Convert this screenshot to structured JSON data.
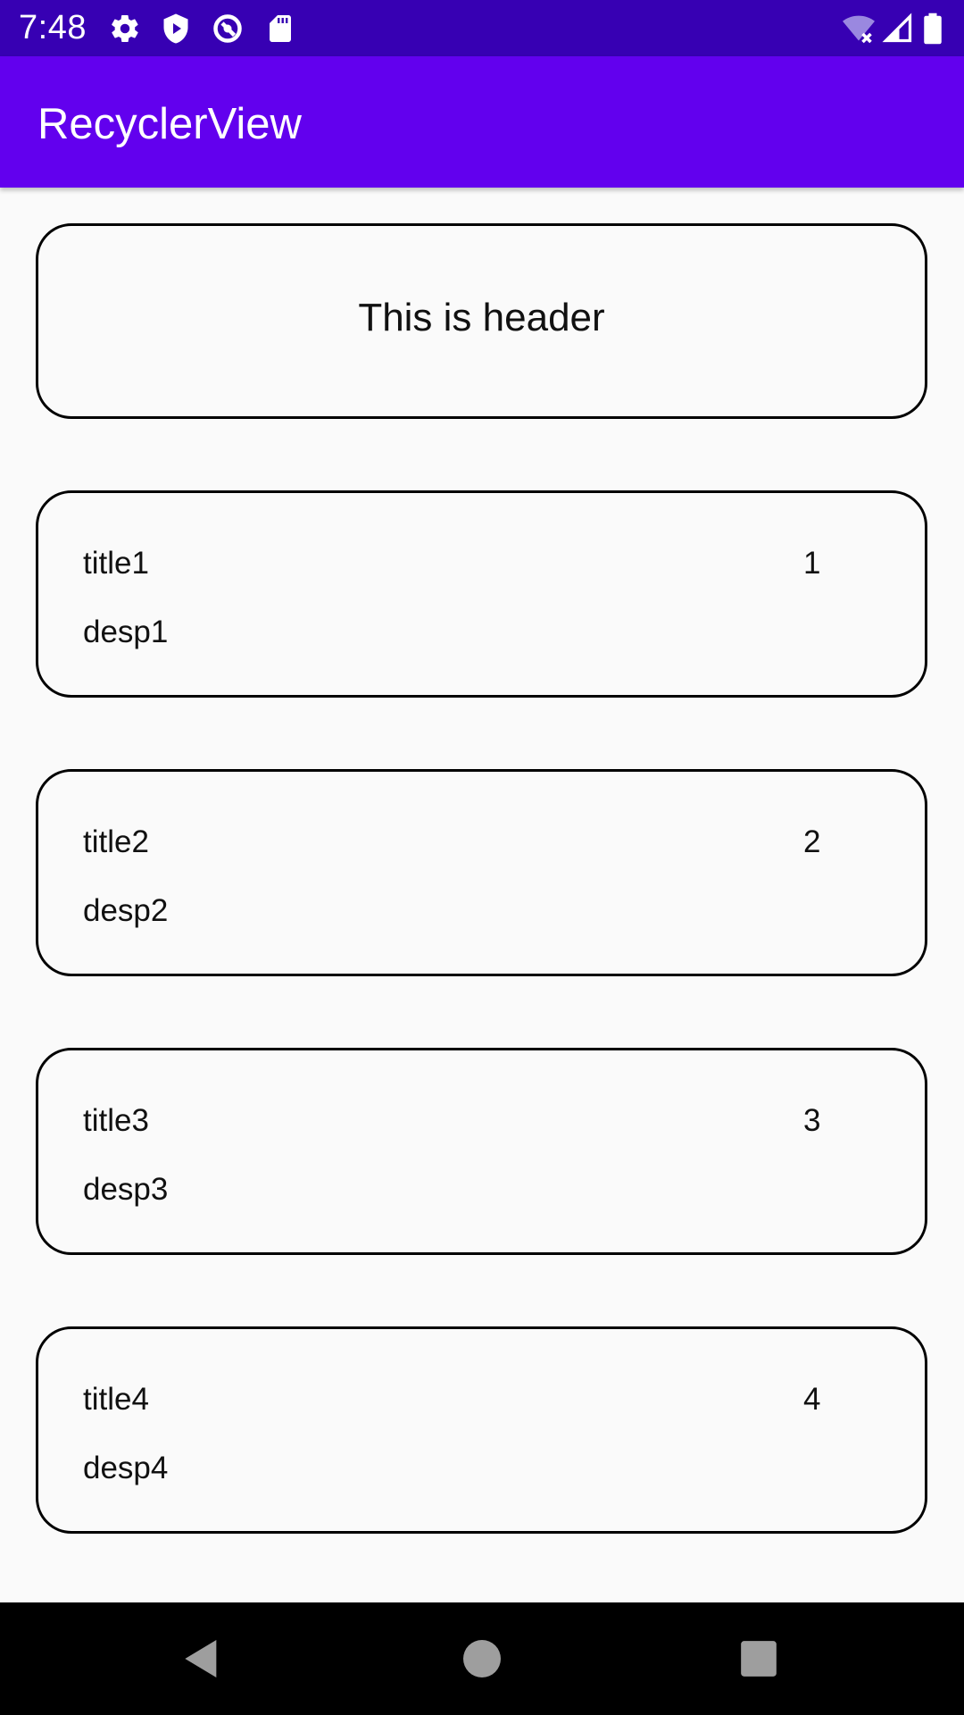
{
  "status_bar": {
    "time": "7:48",
    "icons": [
      "settings-gear-icon",
      "shield-play-icon",
      "sync-circle-icon",
      "sd-card-icon",
      "wifi-off-icon",
      "cell-signal-icon",
      "battery-icon"
    ],
    "bg_color": "#3700b3"
  },
  "app_bar": {
    "title": "RecyclerView",
    "bg_color": "#6200ee"
  },
  "list": {
    "header": {
      "text": "This is header"
    },
    "items": [
      {
        "title": "title1",
        "number": "1",
        "description": "desp1"
      },
      {
        "title": "title2",
        "number": "2",
        "description": "desp2"
      },
      {
        "title": "title3",
        "number": "3",
        "description": "desp3"
      },
      {
        "title": "title4",
        "number": "4",
        "description": "desp4"
      }
    ]
  },
  "nav_bar": {
    "buttons": [
      "back-icon",
      "home-icon",
      "recents-icon"
    ]
  }
}
